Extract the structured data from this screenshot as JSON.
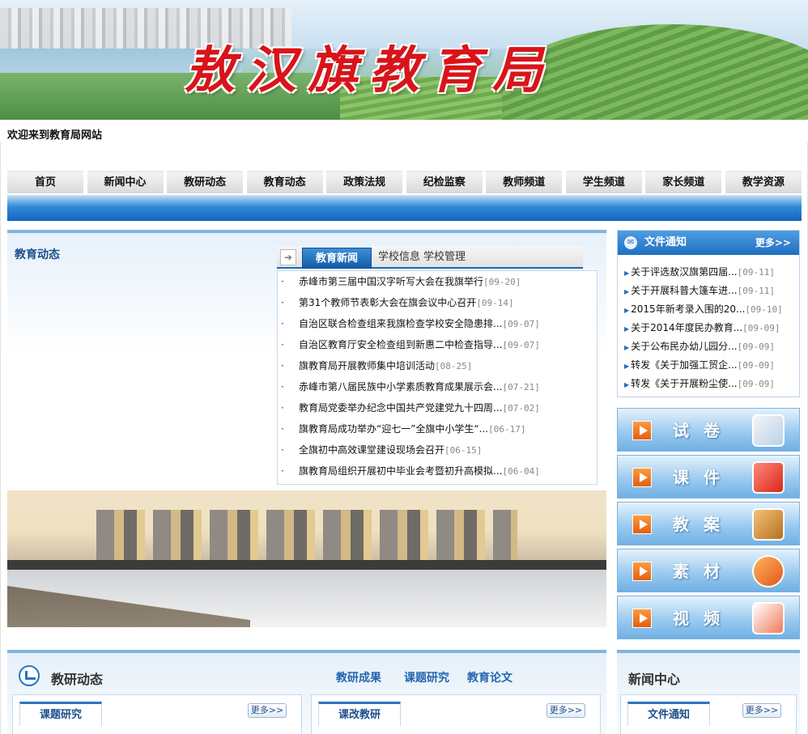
{
  "header": {
    "site_title": "敖汉旗教育局",
    "welcome": "欢迎来到教育局网站"
  },
  "nav": {
    "items": [
      "首页",
      "新闻中心",
      "教研动态",
      "教育动态",
      "政策法规",
      "纪检监察",
      "教师频道",
      "学生频道",
      "家长频道",
      "教学资源"
    ]
  },
  "edu_news": {
    "title": "教育动态",
    "tabs": [
      "教育新闻",
      "学校信息",
      "学校管理"
    ],
    "items": [
      {
        "text": "赤峰市第三届中国汉字听写大会在我旗举行",
        "date": "[09-20]"
      },
      {
        "text": "第31个教师节表彰大会在旗会议中心召开",
        "date": "[09-14]"
      },
      {
        "text": "自治区联合检查组来我旗检查学校安全隐患排...",
        "date": "[09-07]"
      },
      {
        "text": "自治区教育厅安全检查组到新惠二中检查指导...",
        "date": "[09-07]"
      },
      {
        "text": "旗教育局开展教师集中培训活动",
        "date": "[08-25]"
      },
      {
        "text": "赤峰市第八届民族中小学素质教育成果展示会...",
        "date": "[07-21]"
      },
      {
        "text": "教育局党委举办纪念中国共产党建党九十四周...",
        "date": "[07-02]"
      },
      {
        "text": "旗教育局成功举办“迎七一”全旗中小学生“...",
        "date": "[06-17]"
      },
      {
        "text": "全旗初中高效课堂建设现场会召开",
        "date": "[06-15]"
      },
      {
        "text": "旗教育局组织开展初中毕业会考暨初升高模拟...",
        "date": "[06-04]"
      }
    ]
  },
  "notice": {
    "title": "文件通知",
    "more": "更多>>",
    "items": [
      {
        "text": "关于评选敖汉旗第四届...",
        "date": "[09-11]"
      },
      {
        "text": "关于开展科普大篷车进...",
        "date": "[09-11]"
      },
      {
        "text": "2015年新考录入围的20...",
        "date": "[09-10]"
      },
      {
        "text": "关于2014年度民办教育...",
        "date": "[09-09]"
      },
      {
        "text": "关于公布民办幼儿园分...",
        "date": "[09-09]"
      },
      {
        "text": "转发《关于加强工贸企...",
        "date": "[09-09]"
      },
      {
        "text": "转发《关于开展粉尘使...",
        "date": "[09-09]"
      }
    ]
  },
  "resources": {
    "items": [
      "试卷",
      "课件",
      "教案",
      "素材",
      "视频"
    ],
    "icons": [
      "document-pen-icon",
      "presentation-icon",
      "briefcase-icon",
      "ie-folder-icon",
      "ie-media-icon"
    ]
  },
  "research": {
    "title": "教研动态",
    "links": [
      "教研成果",
      "课题研究",
      "教育论文"
    ],
    "box1": {
      "tab": "课题研究",
      "more": "更多>>"
    },
    "box2": {
      "tab": "课改教研",
      "more": "更多>>"
    }
  },
  "news_center": {
    "title": "新闻中心",
    "box": {
      "tab": "文件通知",
      "more": "更多>>"
    }
  },
  "colors": {
    "brand_blue": "#1f6fc0",
    "title_red": "#d8141a"
  }
}
